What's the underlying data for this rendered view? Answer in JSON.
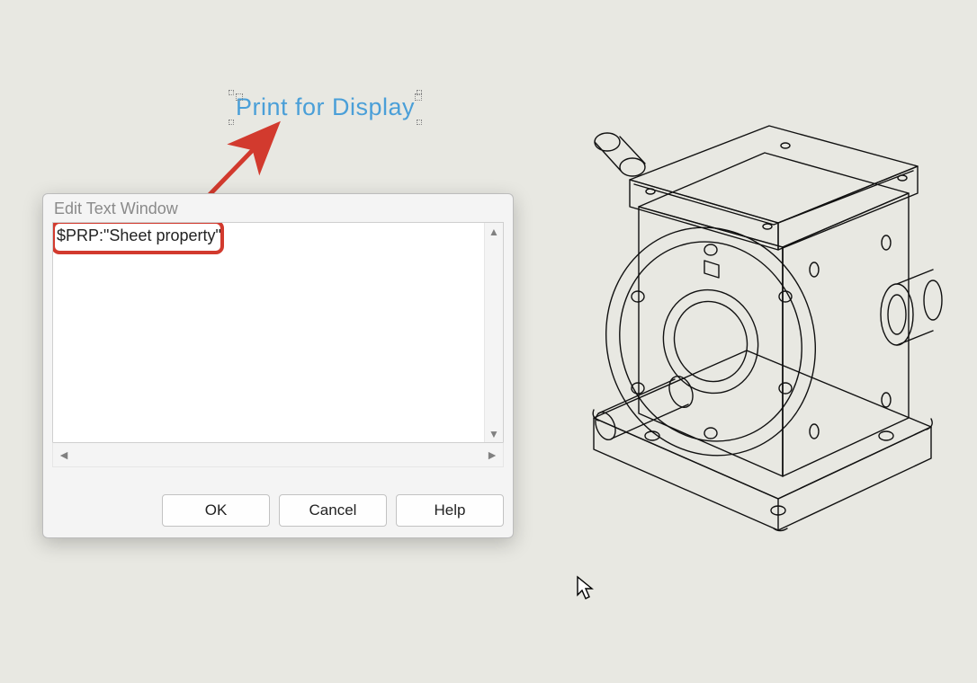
{
  "annotation_text": "Print for Display",
  "dialog": {
    "title": "Edit Text Window",
    "text_value": "$PRP:\"Sheet property\"",
    "buttons": {
      "ok": "OK",
      "cancel": "Cancel",
      "help": "Help"
    }
  }
}
